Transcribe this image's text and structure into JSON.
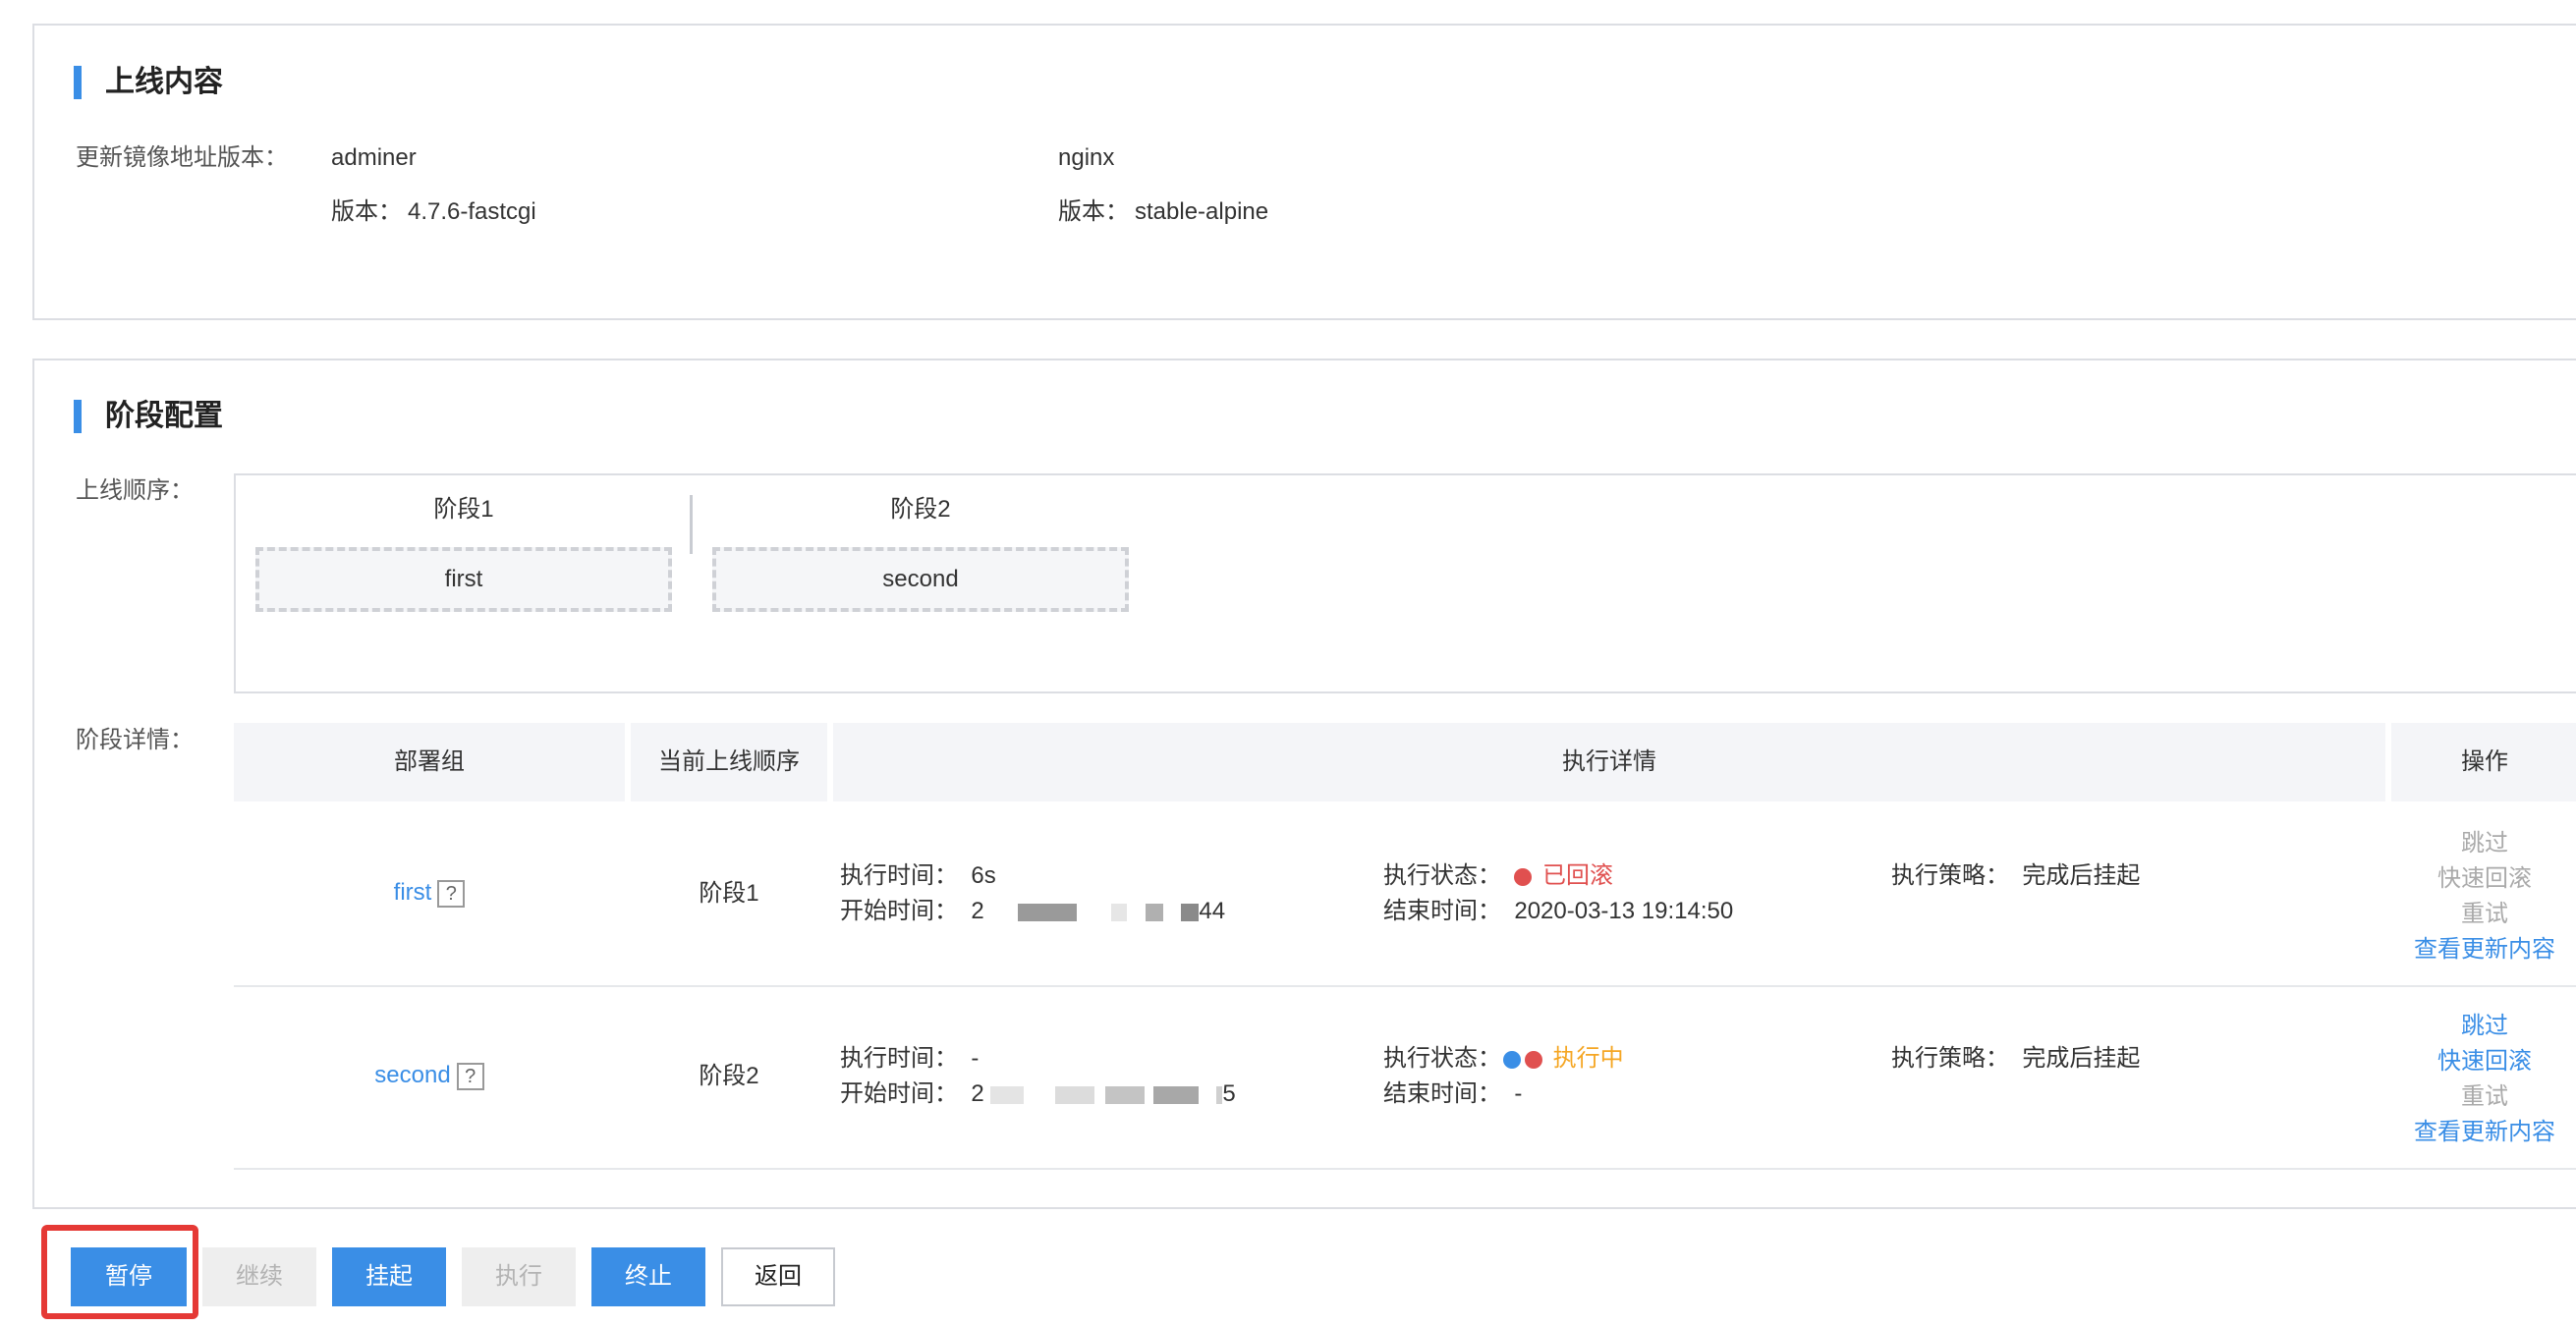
{
  "release_content": {
    "title": "上线内容",
    "update_label": "更新镜像地址版本：",
    "images": [
      {
        "name": "adminer",
        "version_label": "版本：",
        "version": "4.7.6-fastcgi"
      },
      {
        "name": "nginx",
        "version_label": "版本：",
        "version": "stable-alpine"
      }
    ]
  },
  "stage_config": {
    "title": "阶段配置",
    "order_label": "上线顺序：",
    "phases": [
      {
        "name": "阶段1",
        "group": "first"
      },
      {
        "name": "阶段2",
        "group": "second"
      }
    ],
    "detail_label": "阶段详情：",
    "table": {
      "headers": [
        "部署组",
        "当前上线顺序",
        "执行详情",
        "操作"
      ],
      "rows": [
        {
          "group": "first",
          "qmark": "?",
          "phase": "阶段1",
          "exec_time_label": "执行时间：",
          "exec_time": "6s",
          "start_label": "开始时间：",
          "start_prefix": "2",
          "start_suffix": "44",
          "status_label": "执行状态：",
          "status": "已回滚",
          "end_label": "结束时间：",
          "end_time": "2020-03-13 19:14:50",
          "strategy_label": "执行策略：",
          "strategy": "完成后挂起",
          "ops": [
            "跳过",
            "快速回滚",
            "重试",
            "查看更新内容"
          ]
        },
        {
          "group": "second",
          "qmark": "?",
          "phase": "阶段2",
          "exec_time_label": "执行时间：",
          "exec_time": "-",
          "start_label": "开始时间：",
          "start_prefix": "2",
          "start_suffix": "5",
          "status_label": "执行状态：",
          "status": "执行中",
          "end_label": "结束时间：",
          "end_time": "-",
          "strategy_label": "执行策略：",
          "strategy": "完成后挂起",
          "ops": [
            "跳过",
            "快速回滚",
            "重试",
            "查看更新内容"
          ]
        }
      ]
    }
  },
  "buttons": {
    "pause": "暂停",
    "resume": "继续",
    "suspend": "挂起",
    "execute": "执行",
    "terminate": "终止",
    "back": "返回"
  },
  "colors": {
    "primary": "#3a8ee6",
    "danger": "#e0504f",
    "warning": "#f5a623",
    "highlight": "#e53935"
  }
}
